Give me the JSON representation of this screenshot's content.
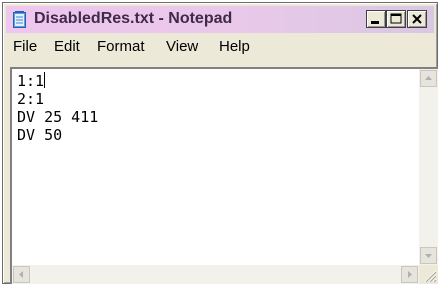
{
  "window": {
    "title": "DisabledRes.txt - Notepad",
    "icon": "notepad-icon"
  },
  "caption_buttons": {
    "minimize_icon": "minimize-icon",
    "maximize_icon": "maximize-icon",
    "close_icon": "close-icon"
  },
  "menubar": {
    "items": [
      {
        "label": "File"
      },
      {
        "label": "Edit"
      },
      {
        "label": "Format"
      },
      {
        "label": "View"
      },
      {
        "label": "Help"
      }
    ]
  },
  "editor": {
    "lines": [
      "1:1",
      "2:1",
      "DV 25 411",
      "DV 50"
    ]
  },
  "colors": {
    "titlebar": "#eec6ee",
    "title_text": "#402a4a",
    "window_face": "#ece9d8",
    "editor_background": "#ffffff"
  }
}
